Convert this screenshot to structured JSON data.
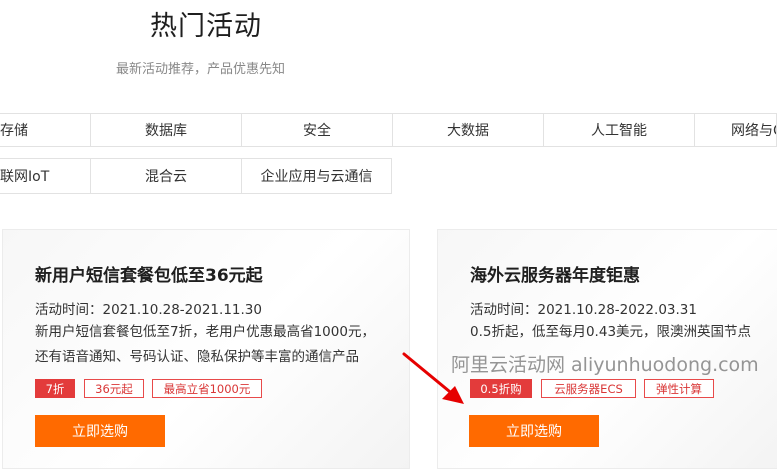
{
  "header": {
    "title": "热门活动",
    "subtitle": "最新活动推荐，产品优惠先知"
  },
  "categories": {
    "row1": [
      "存储",
      "数据库",
      "安全",
      "大数据",
      "人工智能",
      "网络与C"
    ],
    "row2": [
      "联网IoT",
      "混合云",
      "企业应用与云通信"
    ]
  },
  "cards": [
    {
      "title": "新用户短信套餐包低至36元起",
      "date": "活动时间：2021.10.28-2021.11.30",
      "desc_line1": "新用户短信套餐包低至7折，老用户优惠最高省1000元，",
      "desc_line2": "还有语音通知、号码认证、隐私保护等丰富的通信产品",
      "tags": [
        "7折",
        "36元起",
        "最高立省1000元"
      ],
      "button": "立即选购"
    },
    {
      "title": "海外云服务器年度钜惠",
      "date": "活动时间：2021.10.28-2022.03.31",
      "desc_line1": "0.5折起，低至每月0.43美元，限澳洲英国节点",
      "tags": [
        "0.5折购",
        "云服务器ECS",
        "弹性计算"
      ],
      "button": "立即选购"
    }
  ],
  "watermark": "阿里云活动网 aliyunhuodong.com",
  "colors": {
    "accent": "#ff6a00",
    "tag_red": "#e33b3b"
  }
}
